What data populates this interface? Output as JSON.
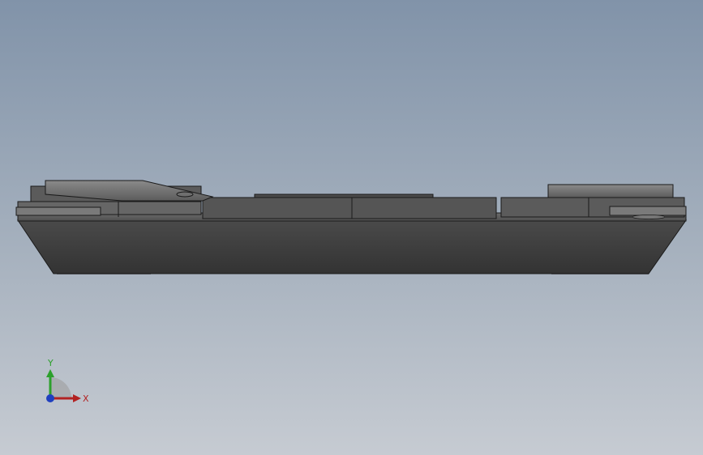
{
  "viewport": {
    "background_top": "#8193a9",
    "background_bottom": "#c6cbd2"
  },
  "model": {
    "body_color": "#3d3d3d",
    "top_plate_color": "#5e5e5e",
    "edge_color": "#1a1a1a"
  },
  "triad": {
    "y_label": "Y",
    "x_label": "X",
    "y_color": "#2ca02c",
    "x_color": "#b22222",
    "z_color": "#1f3fbf"
  }
}
